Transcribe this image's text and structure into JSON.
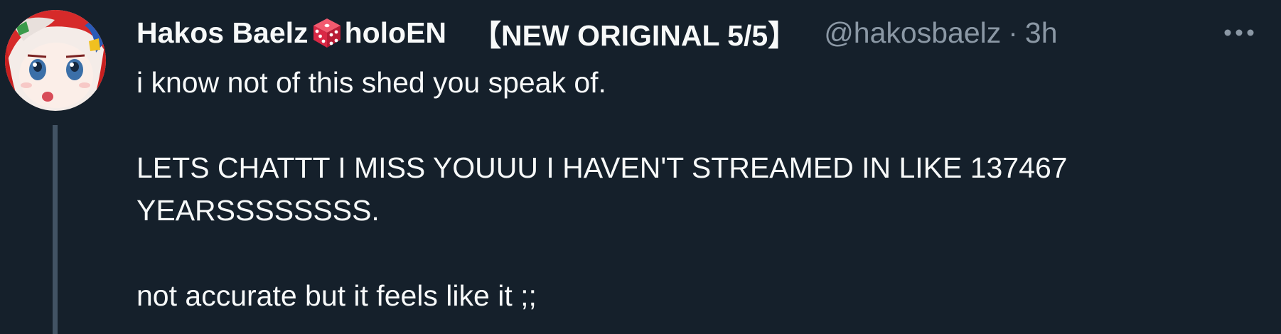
{
  "tweet": {
    "author": {
      "name_first": "Hakos Baelz",
      "name_second": "holoEN",
      "name_badge": "【NEW ORIGINAL 5/5】",
      "handle": "@hakosbaelz",
      "separator": "·",
      "time": "3h"
    },
    "icons": {
      "avatar": "avatar-image",
      "name_emoji": "game-die-icon",
      "more": "more-options-icon"
    },
    "text": {
      "line1": "i know not of this shed you speak of.",
      "line2": "LETS CHATTT I MISS YOUUU I HAVEN'T STREAMED IN LIKE 137467 YEARSSSSSSSS.",
      "line3": "not accurate but it feels like it ;;"
    },
    "colors": {
      "background": "#15202b",
      "primary_text": "#f7f9f9",
      "secondary_text": "#8b98a5",
      "thread_line": "#425364",
      "dice": "#e0304e"
    }
  }
}
